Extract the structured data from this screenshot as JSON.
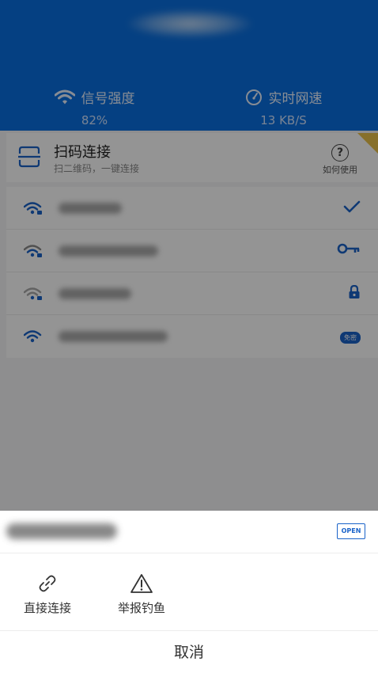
{
  "header": {
    "signal_label": "信号强度",
    "signal_value": "82%",
    "speed_label": "实时网速",
    "speed_value": "13 KB/S",
    "background_color": "#0a6fe0"
  },
  "scan_card": {
    "title": "扫码连接",
    "subtitle": "扫二维码，一键连接",
    "help_label": "如何使用",
    "help_glyph": "?"
  },
  "wifi_list": [
    {
      "icon": "wifi-locked-icon",
      "action_icon": "check-icon"
    },
    {
      "icon": "wifi-locked-icon",
      "action_icon": "key-icon"
    },
    {
      "icon": "wifi-locked-icon",
      "action_icon": "lock-icon"
    },
    {
      "icon": "wifi-icon",
      "action_icon": "password-free-badge",
      "badge_text": "免密"
    }
  ],
  "sheet": {
    "badge": "OPEN",
    "actions": [
      {
        "label": "直接连接",
        "icon": "link-icon"
      },
      {
        "label": "举报钓鱼",
        "icon": "warning-icon"
      }
    ],
    "cancel_label": "取消"
  },
  "colors": {
    "accent": "#1a63c9",
    "overlay": "rgba(0,0,0,0.42)"
  }
}
